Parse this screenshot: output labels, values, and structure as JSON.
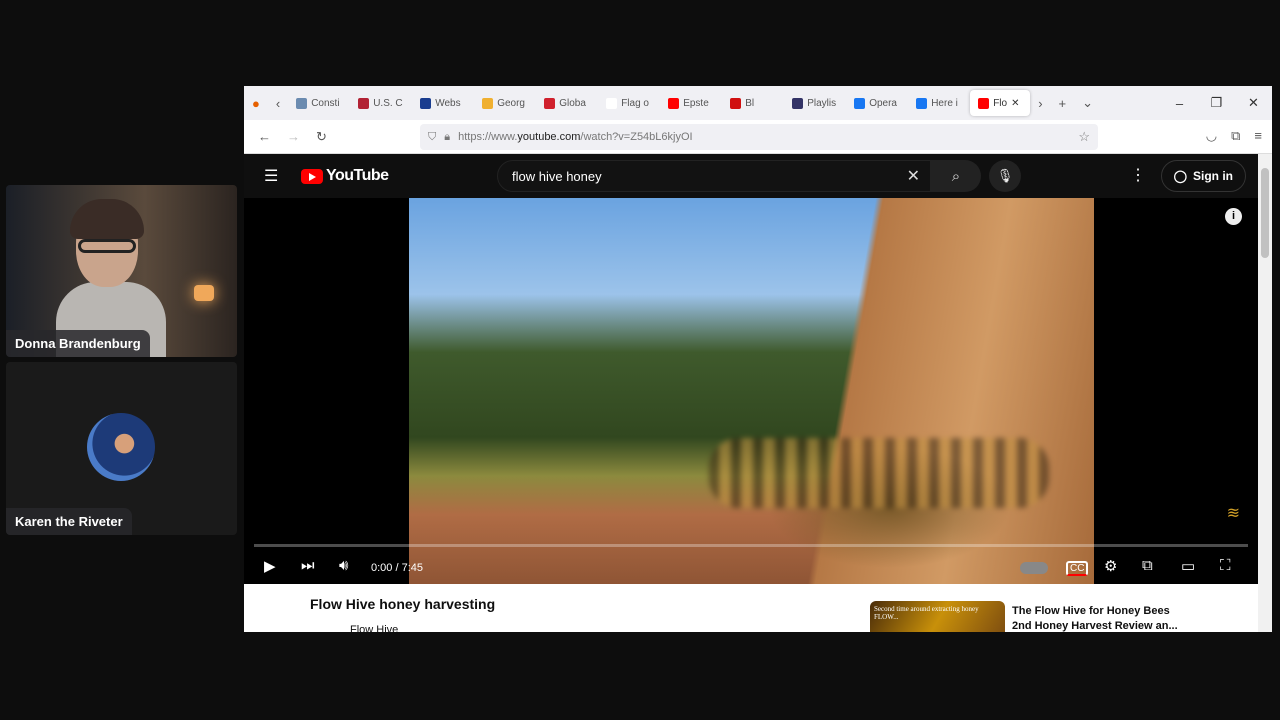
{
  "participants": [
    {
      "name": "Donna Brandenburg"
    },
    {
      "name": "Karen the Riveter"
    }
  ],
  "browser": {
    "tabs": [
      {
        "label": "Consti",
        "icon": "building-icon",
        "color": "#6b8bb0"
      },
      {
        "label": "U.S. C",
        "icon": "us-flag-icon",
        "color": "#b22234"
      },
      {
        "label": "Webs",
        "icon": "j-icon",
        "color": "#1a3d8f"
      },
      {
        "label": "Georg",
        "icon": "flame-icon",
        "color": "#f0b030"
      },
      {
        "label": "Globa",
        "icon": "flag-icon",
        "color": "#d0202c"
      },
      {
        "label": "Flag o",
        "icon": "wikipedia-icon",
        "color": "#ffffff"
      },
      {
        "label": "Epste",
        "icon": "youtube-icon",
        "color": "#ff0000"
      },
      {
        "label": "Bl",
        "icon": "record-icon",
        "color": "#d01010"
      },
      {
        "label": "Playlis",
        "icon": "playlist-icon",
        "color": "#333366"
      },
      {
        "label": "Opera",
        "icon": "facebook-icon",
        "color": "#1877f2"
      },
      {
        "label": "Here i",
        "icon": "facebook-icon",
        "color": "#1877f2"
      },
      {
        "label": "Flo",
        "icon": "youtube-icon",
        "color": "#ff0000",
        "active": true
      }
    ],
    "url_prefix": "https://www.",
    "url_domain": "youtube.com",
    "url_path": "/watch?v=Z54bL6kjyOI"
  },
  "youtube": {
    "logo": "YouTube",
    "search_value": "flow hive honey",
    "sign_in": "Sign in",
    "time": "0:00 / 7:45",
    "progress": 0,
    "video_title": "Flow Hive honey harvesting",
    "channel": "Flow Hive",
    "related": {
      "thumb_text": "Second time around extracting honey FLOW...",
      "title_line1": "The Flow Hive for Honey Bees",
      "title_line2": "2nd Honey Harvest Review an..."
    }
  }
}
